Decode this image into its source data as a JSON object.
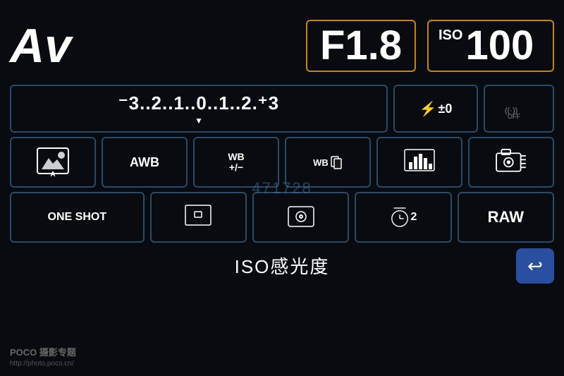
{
  "header": {
    "av_label": "Av",
    "f_value": "F1.8",
    "iso_prefix": "ISO",
    "iso_value": "100"
  },
  "exposure": {
    "scale": "⁻3..2..1..0̲..1..2.⁺3",
    "scale_text": "-3..2..1..0..1..2..+3",
    "flash_label": "⚡±0",
    "wifi_label": "((·)) OFF"
  },
  "row3": {
    "scene_label": "A",
    "awb_label": "AWB",
    "wb_adjust_label": "WB\n+/−",
    "wb2_label": "WB",
    "histogram_label": "",
    "camera_label": ""
  },
  "row4": {
    "one_shot_label": "ONE SHOT",
    "af_label": "",
    "liveview_label": "",
    "timer_label": "",
    "raw_label": "RAW"
  },
  "bottom": {
    "iso_text": "ISO感光度",
    "back_icon": "↩"
  },
  "watermark": {
    "text": "471728",
    "poco_logo": "POCO 摄影专题",
    "poco_url": "http://photo.poco.cn/"
  }
}
